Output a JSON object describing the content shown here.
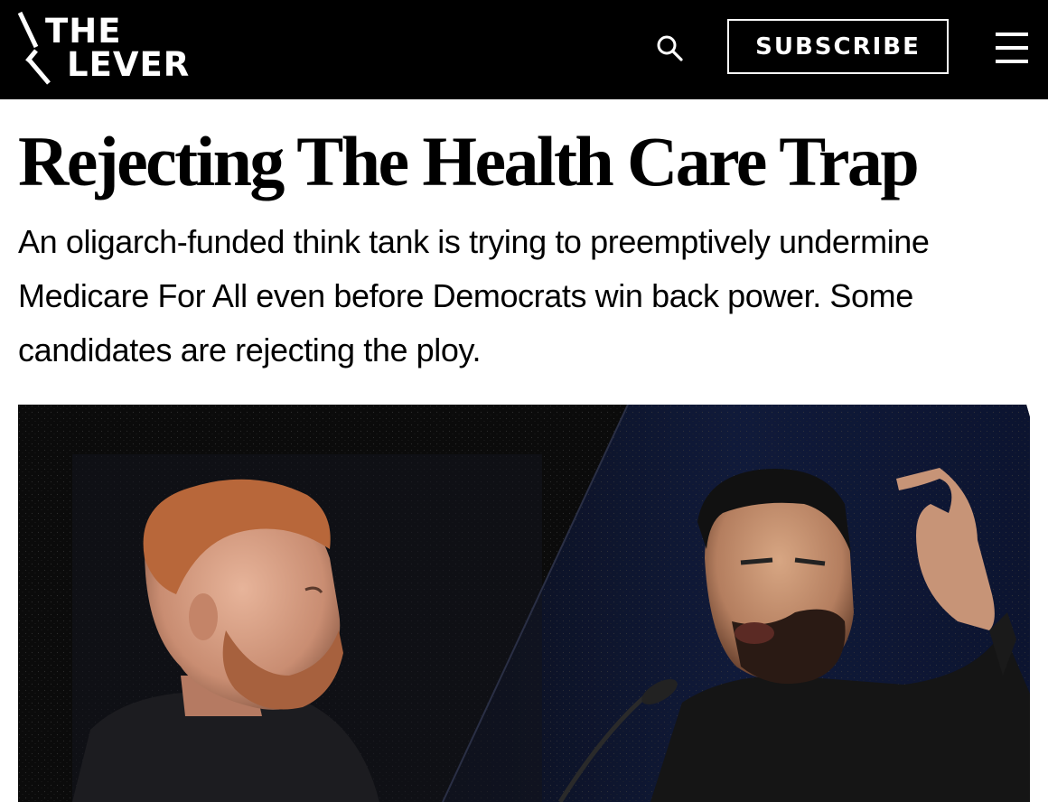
{
  "header": {
    "logo": {
      "line1": "THE",
      "line2": "LEVER"
    },
    "search_icon": "search-icon",
    "subscribe_label": "SUBSCRIBE",
    "menu_icon": "hamburger-menu-icon",
    "background": "#000000",
    "foreground": "#ffffff"
  },
  "article": {
    "headline": "Rejecting The Health Care Trap",
    "dek": "An oligarch-funded think tank is trying to preemptively undermine Medicare For All even before Democrats win back power. Some candidates are rejecting the ploy."
  }
}
